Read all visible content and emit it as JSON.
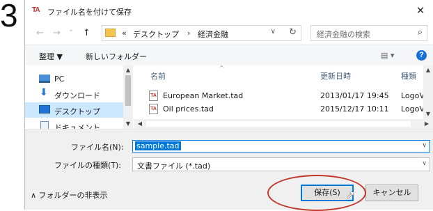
{
  "step_number": "3",
  "window": {
    "app_icon": "TA",
    "title": "ファイル名を付けて保存",
    "close": "✕"
  },
  "nav": {
    "back": "←",
    "forward": "→",
    "recent": "⌄",
    "up": "↑",
    "breadcrumb": [
      "«",
      "デスクトップ",
      "›",
      "経済金融"
    ],
    "search_placeholder": "経済金融の検索"
  },
  "toolbar": {
    "organize": "整理 ▼",
    "new_folder": "新しいフォルダー",
    "view": "▤ ▾",
    "help": "?"
  },
  "nav_pane": {
    "items": [
      {
        "label": "PC",
        "icon": "pc-icon"
      },
      {
        "label": "ダウンロード",
        "icon": "download-icon"
      },
      {
        "label": "デスクトップ",
        "icon": "desktop-icon",
        "selected": true
      },
      {
        "label": "ドキュメント",
        "icon": "documents-icon"
      }
    ]
  },
  "file_list": {
    "columns": [
      "名前",
      "更新日時",
      "種類"
    ],
    "rows": [
      {
        "name": "European Market.tad",
        "modified": "2013/01/17 19:45",
        "type": "LogoV"
      },
      {
        "name": "Oil prices.tad",
        "modified": "2015/12/17 10:11",
        "type": "LogoV"
      }
    ]
  },
  "form": {
    "filename_label": "ファイル名(N):",
    "filename_value": "sample.tad",
    "filetype_label": "ファイルの種類(T):",
    "filetype_value": "文書ファイル (*.tad)",
    "hide_folders": "∧ フォルダーの非表示",
    "save_label": "保存(S)",
    "cancel_label": "キャンセル"
  },
  "colors": {
    "accent": "#0078d7",
    "highlight_ring": "#c0392b",
    "selection": "#cce8ff"
  }
}
